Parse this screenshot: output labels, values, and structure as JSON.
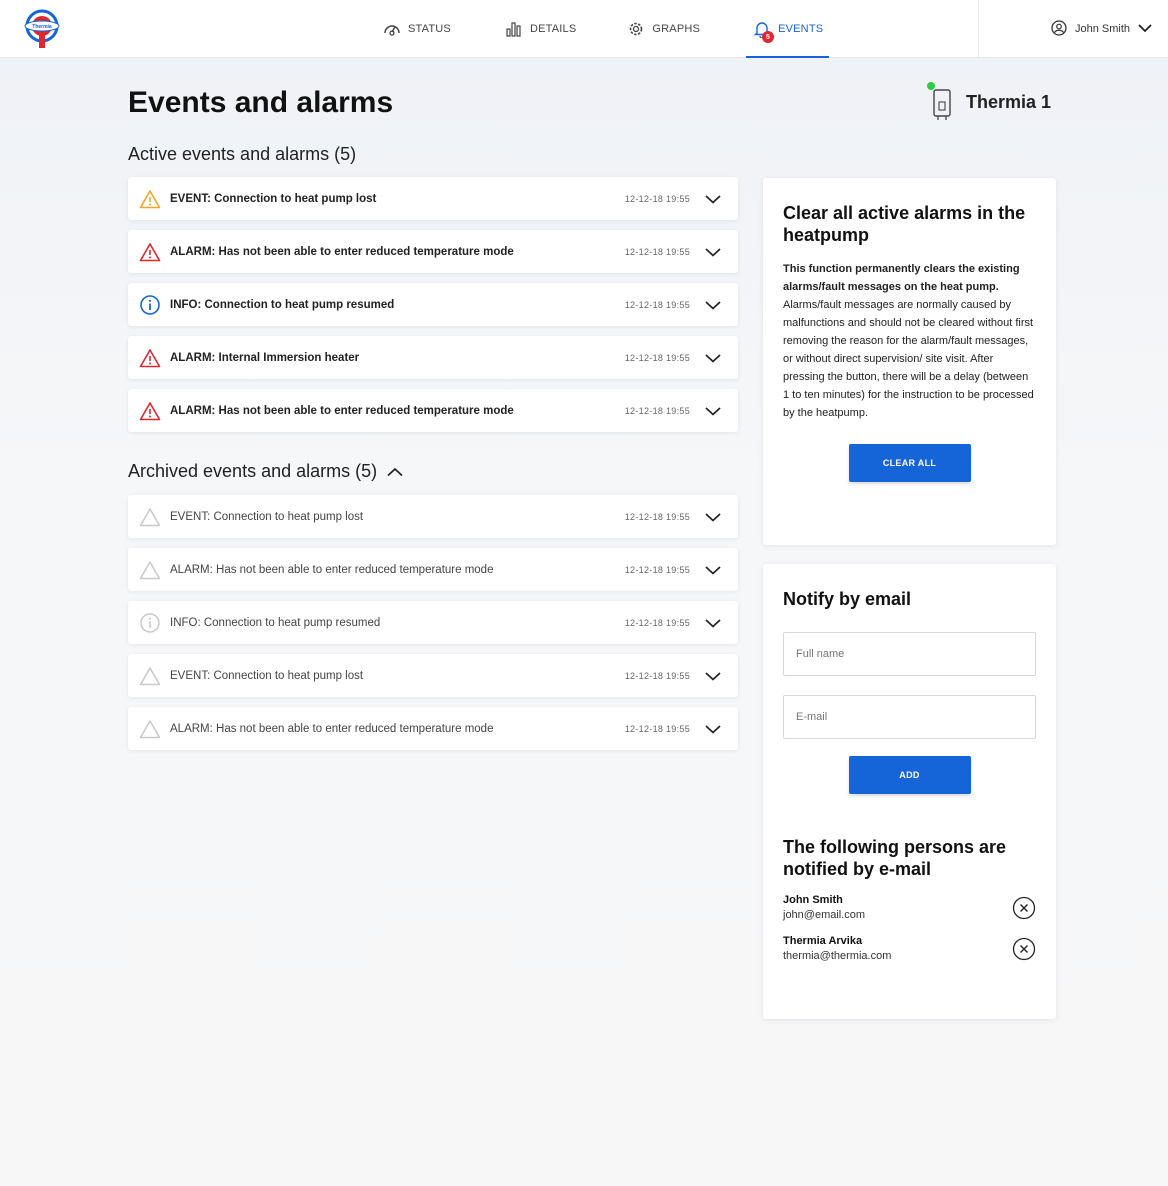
{
  "nav": {
    "items": [
      {
        "label": "STATUS",
        "icon": "gauge-icon"
      },
      {
        "label": "DETAILS",
        "icon": "bar-chart-icon"
      },
      {
        "label": "GRAPHS",
        "icon": "gear-icon"
      },
      {
        "label": "EVENTS",
        "icon": "bell-icon",
        "badge": "5",
        "active": true
      }
    ],
    "user": "John Smith",
    "accent": "#1565d8"
  },
  "page": {
    "title": "Events and alarms",
    "device_name": "Thermia 1"
  },
  "active": {
    "title": "Active events and alarms (5)",
    "rows": [
      {
        "type": "warning",
        "text": "EVENT: Connection to heat pump lost",
        "time": "12-12-18 19:55"
      },
      {
        "type": "alarm",
        "text": "ALARM: Has not been able to enter reduced temperature mode",
        "time": "12-12-18 19:55"
      },
      {
        "type": "info",
        "text": "INFO: Connection to heat pump resumed",
        "time": "12-12-18 19:55"
      },
      {
        "type": "alarm",
        "text": "ALARM: Internal Immersion heater",
        "time": "12-12-18 19:55"
      },
      {
        "type": "alarm",
        "text": "ALARM: Has not been able to enter reduced temperature mode",
        "time": "12-12-18 19:55"
      }
    ]
  },
  "archived": {
    "title": "Archived events and alarms (5)",
    "rows": [
      {
        "type": "warning",
        "text": "EVENT: Connection to heat pump lost",
        "time": "12-12-18 19:55"
      },
      {
        "type": "warning",
        "text": "ALARM: Has not been able to enter reduced temperature mode",
        "time": "12-12-18 19:55"
      },
      {
        "type": "info",
        "text": "INFO: Connection to heat pump resumed",
        "time": "12-12-18 19:55"
      },
      {
        "type": "warning",
        "text": "EVENT: Connection to heat pump lost",
        "time": "12-12-18 19:55"
      },
      {
        "type": "warning",
        "text": "ALARM: Has not been able to enter reduced temperature mode",
        "time": "12-12-18 19:55"
      }
    ]
  },
  "clear_card": {
    "title": "Clear all active alarms in the heatpump",
    "bold_text": "This function permanently clears the existing alarms/fault messages on the heat pump.",
    "text": " Alarms/fault messages are normally caused by malfunctions and should not be cleared without first removing the reason for the alarm/fault messages, or without direct supervision/ site visit. After pressing the button, there will be a delay (between 1 to ten minutes) for the instruction to be processed by the heatpump.",
    "button": "CLEAR ALL"
  },
  "notify_card": {
    "title": "Notify by email",
    "name_placeholder": "Full name",
    "email_placeholder": "E-mail",
    "button": "ADD",
    "list_title": "The following persons are notified by e-mail",
    "persons": [
      {
        "name": "John Smith",
        "email": "john@email.com"
      },
      {
        "name": "Thermia Arvika",
        "email": "thermia@thermia.com"
      }
    ]
  },
  "colors": {
    "warning": "#f4a623",
    "alarm": "#e0262f",
    "info": "#1565d8",
    "archived": "#c9c9c9",
    "online": "#2ecc40"
  }
}
